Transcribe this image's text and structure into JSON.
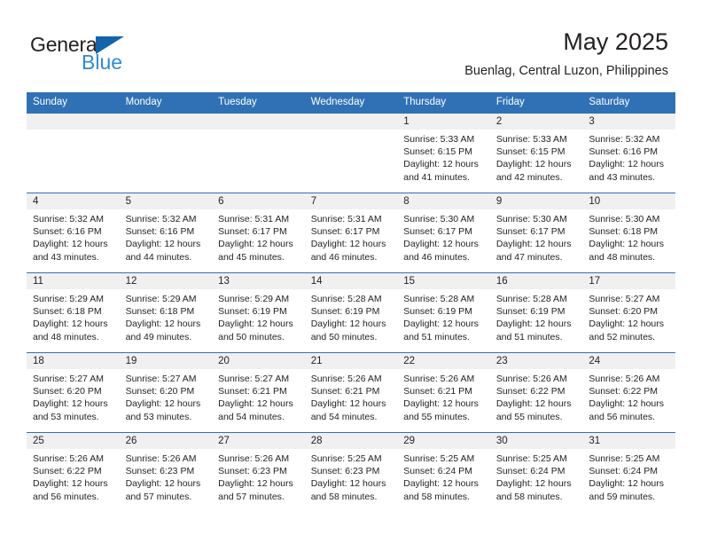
{
  "brand": {
    "name_top": "General",
    "name_bottom": "Blue",
    "triangle_color": "#1464aa",
    "blue_color": "#2e8bd4"
  },
  "header": {
    "title": "May 2025",
    "location": "Buenlag, Central Luzon, Philippines"
  },
  "theme": {
    "header_blue": "#3071b5",
    "date_strip_gray": "#f0f0f0",
    "text_color": "#231f20"
  },
  "weekday_headers": [
    "Sunday",
    "Monday",
    "Tuesday",
    "Wednesday",
    "Thursday",
    "Friday",
    "Saturday"
  ],
  "weeks": [
    [
      {
        "empty": true
      },
      {
        "empty": true
      },
      {
        "empty": true
      },
      {
        "empty": true
      },
      {
        "date": "1",
        "sunrise": "Sunrise: 5:33 AM",
        "sunset": "Sunset: 6:15 PM",
        "daylight": "Daylight: 12 hours and 41 minutes."
      },
      {
        "date": "2",
        "sunrise": "Sunrise: 5:33 AM",
        "sunset": "Sunset: 6:15 PM",
        "daylight": "Daylight: 12 hours and 42 minutes."
      },
      {
        "date": "3",
        "sunrise": "Sunrise: 5:32 AM",
        "sunset": "Sunset: 6:16 PM",
        "daylight": "Daylight: 12 hours and 43 minutes."
      }
    ],
    [
      {
        "date": "4",
        "sunrise": "Sunrise: 5:32 AM",
        "sunset": "Sunset: 6:16 PM",
        "daylight": "Daylight: 12 hours and 43 minutes."
      },
      {
        "date": "5",
        "sunrise": "Sunrise: 5:32 AM",
        "sunset": "Sunset: 6:16 PM",
        "daylight": "Daylight: 12 hours and 44 minutes."
      },
      {
        "date": "6",
        "sunrise": "Sunrise: 5:31 AM",
        "sunset": "Sunset: 6:17 PM",
        "daylight": "Daylight: 12 hours and 45 minutes."
      },
      {
        "date": "7",
        "sunrise": "Sunrise: 5:31 AM",
        "sunset": "Sunset: 6:17 PM",
        "daylight": "Daylight: 12 hours and 46 minutes."
      },
      {
        "date": "8",
        "sunrise": "Sunrise: 5:30 AM",
        "sunset": "Sunset: 6:17 PM",
        "daylight": "Daylight: 12 hours and 46 minutes."
      },
      {
        "date": "9",
        "sunrise": "Sunrise: 5:30 AM",
        "sunset": "Sunset: 6:17 PM",
        "daylight": "Daylight: 12 hours and 47 minutes."
      },
      {
        "date": "10",
        "sunrise": "Sunrise: 5:30 AM",
        "sunset": "Sunset: 6:18 PM",
        "daylight": "Daylight: 12 hours and 48 minutes."
      }
    ],
    [
      {
        "date": "11",
        "sunrise": "Sunrise: 5:29 AM",
        "sunset": "Sunset: 6:18 PM",
        "daylight": "Daylight: 12 hours and 48 minutes."
      },
      {
        "date": "12",
        "sunrise": "Sunrise: 5:29 AM",
        "sunset": "Sunset: 6:18 PM",
        "daylight": "Daylight: 12 hours and 49 minutes."
      },
      {
        "date": "13",
        "sunrise": "Sunrise: 5:29 AM",
        "sunset": "Sunset: 6:19 PM",
        "daylight": "Daylight: 12 hours and 50 minutes."
      },
      {
        "date": "14",
        "sunrise": "Sunrise: 5:28 AM",
        "sunset": "Sunset: 6:19 PM",
        "daylight": "Daylight: 12 hours and 50 minutes."
      },
      {
        "date": "15",
        "sunrise": "Sunrise: 5:28 AM",
        "sunset": "Sunset: 6:19 PM",
        "daylight": "Daylight: 12 hours and 51 minutes."
      },
      {
        "date": "16",
        "sunrise": "Sunrise: 5:28 AM",
        "sunset": "Sunset: 6:19 PM",
        "daylight": "Daylight: 12 hours and 51 minutes."
      },
      {
        "date": "17",
        "sunrise": "Sunrise: 5:27 AM",
        "sunset": "Sunset: 6:20 PM",
        "daylight": "Daylight: 12 hours and 52 minutes."
      }
    ],
    [
      {
        "date": "18",
        "sunrise": "Sunrise: 5:27 AM",
        "sunset": "Sunset: 6:20 PM",
        "daylight": "Daylight: 12 hours and 53 minutes."
      },
      {
        "date": "19",
        "sunrise": "Sunrise: 5:27 AM",
        "sunset": "Sunset: 6:20 PM",
        "daylight": "Daylight: 12 hours and 53 minutes."
      },
      {
        "date": "20",
        "sunrise": "Sunrise: 5:27 AM",
        "sunset": "Sunset: 6:21 PM",
        "daylight": "Daylight: 12 hours and 54 minutes."
      },
      {
        "date": "21",
        "sunrise": "Sunrise: 5:26 AM",
        "sunset": "Sunset: 6:21 PM",
        "daylight": "Daylight: 12 hours and 54 minutes."
      },
      {
        "date": "22",
        "sunrise": "Sunrise: 5:26 AM",
        "sunset": "Sunset: 6:21 PM",
        "daylight": "Daylight: 12 hours and 55 minutes."
      },
      {
        "date": "23",
        "sunrise": "Sunrise: 5:26 AM",
        "sunset": "Sunset: 6:22 PM",
        "daylight": "Daylight: 12 hours and 55 minutes."
      },
      {
        "date": "24",
        "sunrise": "Sunrise: 5:26 AM",
        "sunset": "Sunset: 6:22 PM",
        "daylight": "Daylight: 12 hours and 56 minutes."
      }
    ],
    [
      {
        "date": "25",
        "sunrise": "Sunrise: 5:26 AM",
        "sunset": "Sunset: 6:22 PM",
        "daylight": "Daylight: 12 hours and 56 minutes."
      },
      {
        "date": "26",
        "sunrise": "Sunrise: 5:26 AM",
        "sunset": "Sunset: 6:23 PM",
        "daylight": "Daylight: 12 hours and 57 minutes."
      },
      {
        "date": "27",
        "sunrise": "Sunrise: 5:26 AM",
        "sunset": "Sunset: 6:23 PM",
        "daylight": "Daylight: 12 hours and 57 minutes."
      },
      {
        "date": "28",
        "sunrise": "Sunrise: 5:25 AM",
        "sunset": "Sunset: 6:23 PM",
        "daylight": "Daylight: 12 hours and 58 minutes."
      },
      {
        "date": "29",
        "sunrise": "Sunrise: 5:25 AM",
        "sunset": "Sunset: 6:24 PM",
        "daylight": "Daylight: 12 hours and 58 minutes."
      },
      {
        "date": "30",
        "sunrise": "Sunrise: 5:25 AM",
        "sunset": "Sunset: 6:24 PM",
        "daylight": "Daylight: 12 hours and 58 minutes."
      },
      {
        "date": "31",
        "sunrise": "Sunrise: 5:25 AM",
        "sunset": "Sunset: 6:24 PM",
        "daylight": "Daylight: 12 hours and 59 minutes."
      }
    ]
  ]
}
